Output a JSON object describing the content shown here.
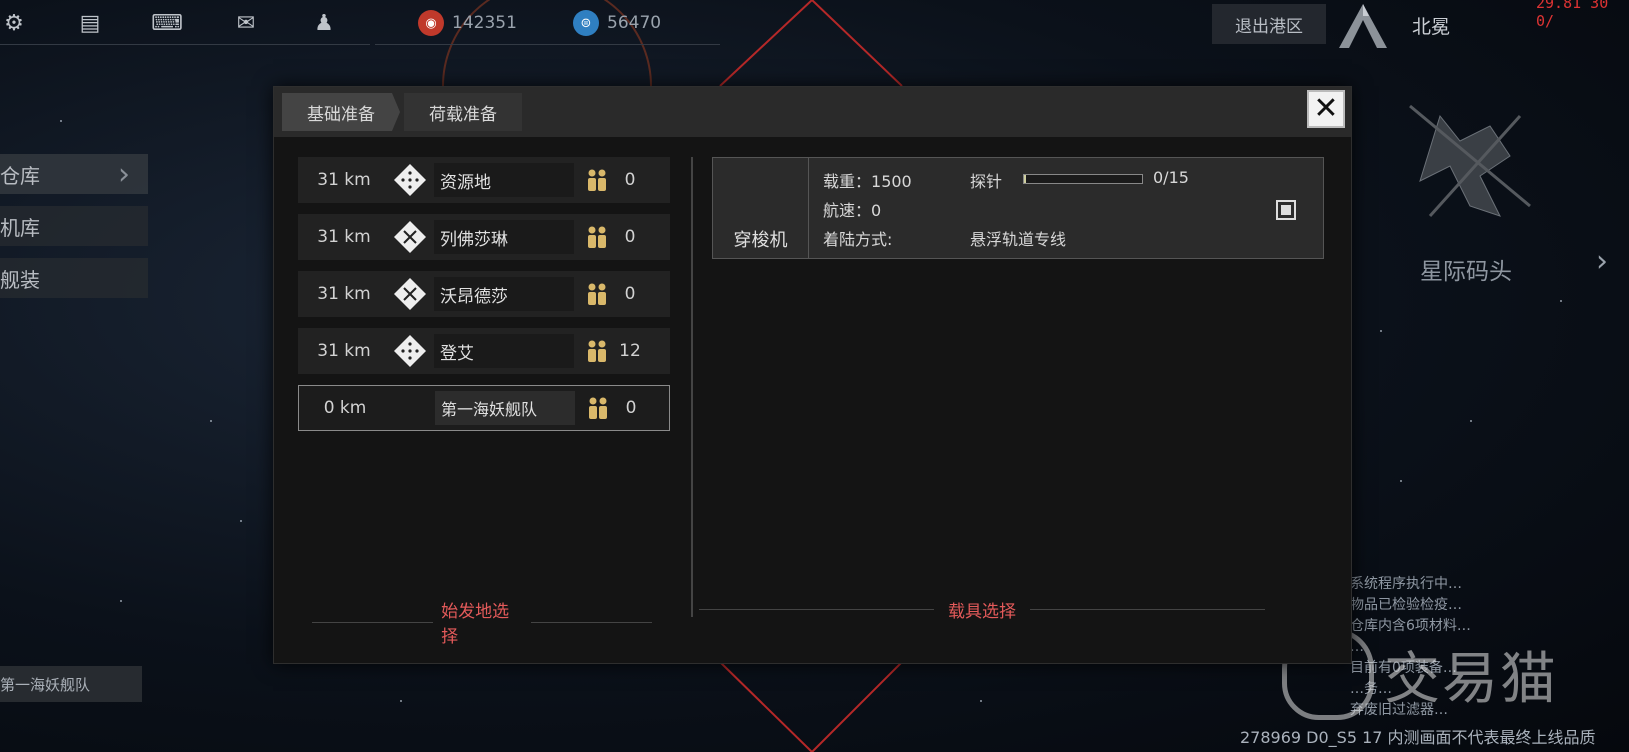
{
  "topbar": {
    "icons": [
      "gear-icon",
      "chat-icon",
      "keyboard-icon",
      "mail-icon",
      "contacts-icon"
    ],
    "resources": [
      {
        "icon": "red-currency-icon",
        "value": "142351",
        "color": "#c0392b"
      },
      {
        "icon": "blue-currency-icon",
        "value": "56470",
        "color": "#2f7fc1"
      }
    ],
    "exit_label": "退出港区",
    "player_name": "北冕",
    "red_coords": "29.81 30 0/"
  },
  "side_menu": {
    "items": [
      "仓库",
      "机库",
      "舰装"
    ],
    "fleet_label": "第一海妖舰队"
  },
  "right_side": {
    "dock_label": "星际码头",
    "sys_log": [
      "系统程序执行中…",
      "物品已检验检疫…",
      "仓库内含6项材料…",
      "…",
      "目前有0项装备…",
      "…务…",
      "弃废旧过滤器…"
    ],
    "build_info": "278969 D0_S5 17  内测画面不代表最终上线品质",
    "watermark": "交易猫"
  },
  "dialog": {
    "tabs": [
      "基础准备",
      "荷载准备"
    ],
    "close_label": "✕",
    "origins": [
      {
        "distance": "31 km",
        "name": "资源地",
        "count": "0",
        "icon": "dotted-diamond-icon"
      },
      {
        "distance": "31 km",
        "name": "列佛莎琳",
        "count": "0",
        "icon": "x-diamond-icon"
      },
      {
        "distance": "31 km",
        "name": "沃昂德莎",
        "count": "0",
        "icon": "x-diamond-icon"
      },
      {
        "distance": "31 km",
        "name": "登艾",
        "count": "12",
        "icon": "dotted-diamond-icon"
      },
      {
        "distance": "0 km",
        "name": "第一海妖舰队",
        "count": "0",
        "icon": ""
      }
    ],
    "origin_section_title": "始发地选择",
    "vehicle_section_title": "载具选择",
    "vehicle": {
      "name": "穿梭机",
      "load_label": "载重：",
      "load_value": "1500",
      "speed_label": "航速：",
      "speed_value": "0",
      "landing_label": "着陆方式:",
      "landing_value": "悬浮轨道专线",
      "probe_label": "探针",
      "probe_value": "0/15",
      "probe_fraction": 0.0
    }
  }
}
